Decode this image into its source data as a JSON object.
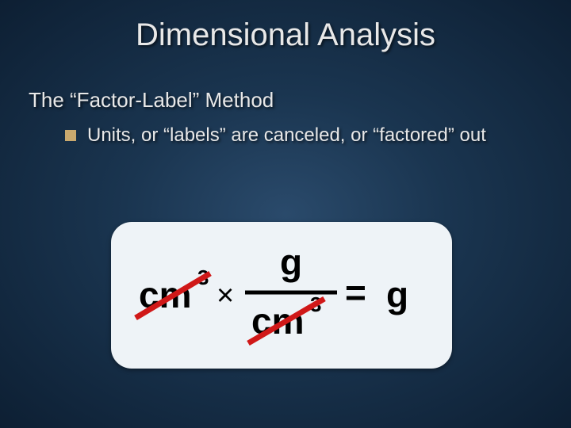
{
  "title": "Dimensional Analysis",
  "subtitle": "The “Factor-Label” Method",
  "bullet1": "Units, or “labels” are canceled, or “factored” out",
  "equation": {
    "left_unit": "cm",
    "left_exponent": "3",
    "numerator": "g",
    "denominator_unit": "cm",
    "denominator_exponent": "3",
    "result": "g"
  }
}
